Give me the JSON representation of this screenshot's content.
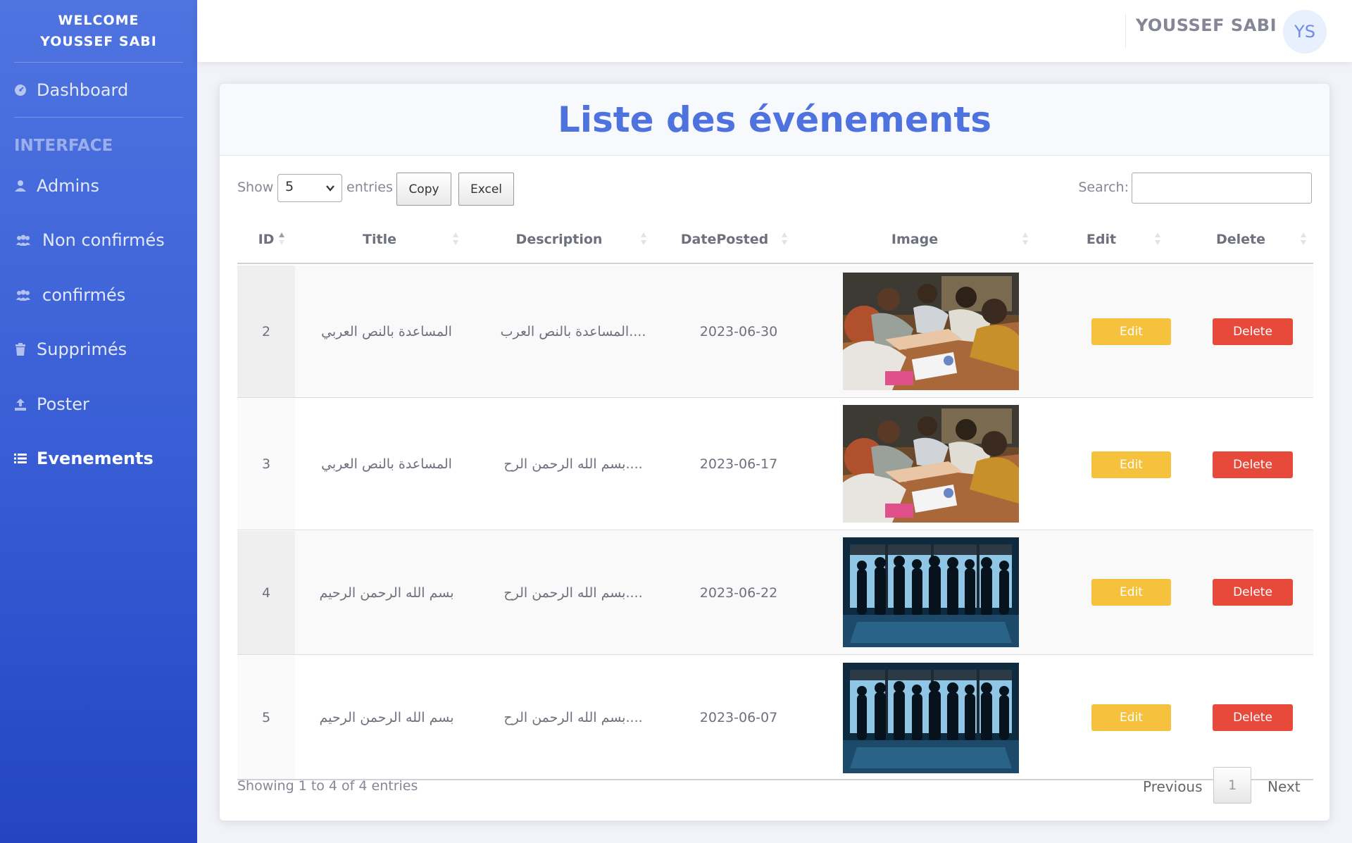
{
  "sidebar": {
    "brand_line1": "WELCOME",
    "brand_line2": "YOUSSEF SABI",
    "dashboard": "Dashboard",
    "heading": "INTERFACE",
    "items": [
      {
        "label": "Admins",
        "icon": "user-icon"
      },
      {
        "label": "Non confirmés",
        "icon": "users-icon"
      },
      {
        "label": "confirmés",
        "icon": "users-icon"
      },
      {
        "label": "Supprimés",
        "icon": "trash-icon"
      },
      {
        "label": "Poster",
        "icon": "upload-icon"
      },
      {
        "label": "Evenements",
        "icon": "list-icon",
        "active": true
      }
    ]
  },
  "topbar": {
    "username": "YOUSSEF SABI",
    "avatar_initials": "YS"
  },
  "card": {
    "title": "Liste des événements"
  },
  "controls": {
    "show_label": "Show",
    "page_length": "5",
    "entries_label": "entries",
    "copy_label": "Copy",
    "excel_label": "Excel",
    "search_label": "Search:",
    "search_value": ""
  },
  "table": {
    "columns": [
      "ID",
      "Title",
      "Description",
      "DatePosted",
      "Image",
      "Edit",
      "Delete"
    ],
    "rows": [
      {
        "id": "2",
        "title": "المساعدة بالنص العربي",
        "description": "المساعدة بالنص العرب....",
        "date": "2023-06-30",
        "image": "team-hands-photo",
        "edit": "Edit",
        "delete": "Delete"
      },
      {
        "id": "3",
        "title": "المساعدة بالنص العربي",
        "description": "بسم الله الرحمن الرح....",
        "date": "2023-06-17",
        "image": "team-hands-photo",
        "edit": "Edit",
        "delete": "Delete"
      },
      {
        "id": "4",
        "title": "بسم الله الرحمن الرحيم",
        "description": "بسم الله الرحمن الرح....",
        "date": "2023-06-22",
        "image": "office-silhouettes-photo",
        "edit": "Edit",
        "delete": "Delete"
      },
      {
        "id": "5",
        "title": "بسم الله الرحمن الرحيم",
        "description": "بسم الله الرحمن الرح....",
        "date": "2023-06-07",
        "image": "office-silhouettes-photo",
        "edit": "Edit",
        "delete": "Delete"
      }
    ]
  },
  "footer": {
    "info": "Showing 1 to 4 of 4 entries",
    "previous": "Previous",
    "page": "1",
    "next": "Next"
  },
  "colors": {
    "primary": "#4e73df",
    "warning": "#f6c23e",
    "danger": "#e74a3b"
  }
}
